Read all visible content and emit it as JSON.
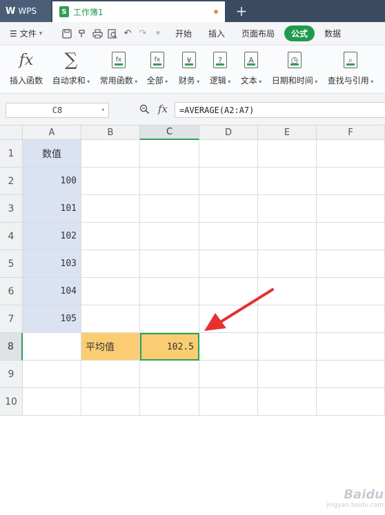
{
  "titlebar": {
    "app_label": "WPS",
    "doc_icon_letter": "S",
    "doc_title": "工作簿1",
    "new_tab_glyph": "+"
  },
  "menubar": {
    "file_label": "文件",
    "tabs": [
      "开始",
      "插入",
      "页面布局",
      "公式",
      "数据"
    ],
    "active_tab": "公式"
  },
  "ribbon": {
    "items": [
      {
        "label": "插入函数",
        "icon": "fx-icon"
      },
      {
        "label": "自动求和",
        "icon": "sigma-icon",
        "dropdown": true
      },
      {
        "label": "常用函数",
        "icon": "star-fx-icon",
        "dropdown": true
      },
      {
        "label": "全部",
        "icon": "fx-box-icon",
        "dropdown": true
      },
      {
        "label": "财务",
        "icon": "yen-book-icon",
        "dropdown": true
      },
      {
        "label": "逻辑",
        "icon": "question-book-icon",
        "dropdown": true
      },
      {
        "label": "文本",
        "icon": "a-book-icon",
        "dropdown": true
      },
      {
        "label": "日期和时间",
        "icon": "clock-book-icon",
        "dropdown": true
      },
      {
        "label": "查找与引用",
        "icon": "search-book-icon",
        "dropdown": true
      }
    ],
    "icon_glyphs": {
      "fx": "fx",
      "sigma": "∑",
      "yen": "¥",
      "question": "?",
      "a": "A",
      "clock": "◷",
      "search": "⌕"
    }
  },
  "formula_bar": {
    "name_box": "C8",
    "fx_label": "fx",
    "formula": "=AVERAGE(A2:A7)"
  },
  "grid": {
    "columns": [
      "A",
      "B",
      "C",
      "D",
      "E",
      "F"
    ],
    "rows": [
      "1",
      "2",
      "3",
      "4",
      "5",
      "6",
      "7",
      "8",
      "9",
      "10"
    ],
    "selected_cell": "C8",
    "cells": {
      "A1": "数值",
      "A2": "100",
      "A3": "101",
      "A4": "102",
      "A5": "103",
      "A6": "104",
      "A7": "105",
      "B8": "平均值",
      "C8": "102.5"
    }
  },
  "colors": {
    "accent": "#1f9b4e",
    "value_fill": "#dbe2f1",
    "label_fill": "#fbcd72",
    "arrow": "#e5312f"
  },
  "watermark": {
    "brand": "Baidu",
    "sub": "jingyan.baidu.com"
  }
}
